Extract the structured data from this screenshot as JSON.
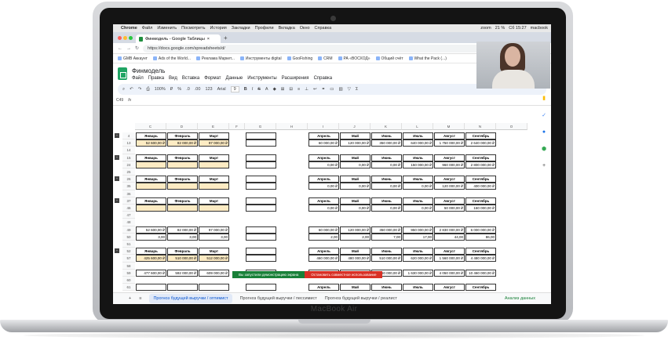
{
  "device": {
    "brand": "MacBook Air"
  },
  "macbar": {
    "app": "Chrome",
    "menu": [
      "Файл",
      "Изменить",
      "Посмотреть",
      "История",
      "Закладки",
      "Профили",
      "Вкладка",
      "Окно",
      "Справка"
    ],
    "zoom": "zoom",
    "battery": "21 %",
    "clock": "Сб 15:27",
    "user": "macbook"
  },
  "browser": {
    "tab_title": "Финмодель - Google Таблицы",
    "url": "https://docs.google.com/spreadsheets/d/",
    "bookmarks": [
      "GMB Аккаунт",
      "Ads of the World...",
      "Реклама Маркет...",
      "Инструменты digital",
      "GooFishing",
      "CRM",
      "РА «ВОСХОД»",
      "Общий счёт",
      "What the Pack (...)"
    ]
  },
  "doc": {
    "title": "Финмодель",
    "menus": [
      "Файл",
      "Правка",
      "Вид",
      "Вставка",
      "Формат",
      "Данные",
      "Инструменты",
      "Расширения",
      "Справка"
    ]
  },
  "toolbar": {
    "zoom": "100%",
    "currency": "₽",
    "percent": "%",
    "dec1": ".0",
    "dec2": ".00",
    "numfmt": "123",
    "font": "Arial",
    "size": "9"
  },
  "formula": {
    "cellref": "C49",
    "fx": "fx"
  },
  "columns": [
    "C",
    "D",
    "E",
    "F",
    "G",
    "H",
    "I",
    "J",
    "K",
    "L",
    "M",
    "N",
    "O"
  ],
  "rows": [
    {
      "n": "4",
      "left": [
        "Январь",
        "Февраль",
        "Март"
      ],
      "right": [
        "Апрель",
        "Май",
        "Июнь",
        "Июль",
        "Август",
        "Сентябрь"
      ],
      "hdr": true,
      "grp": "-"
    },
    {
      "n": "13",
      "left": [
        "52 600,00 ₽",
        "82 000,00 ₽",
        "97 000,00 ₽"
      ],
      "right": [
        "60 000,00 ₽",
        "120 000,00 ₽",
        "350 000,00 ₽",
        "640 000,00 ₽",
        "1 750 000,00 ₽",
        "2 640 000,00 ₽"
      ],
      "yl": true
    },
    {
      "n": "14",
      "left": [
        "",
        "",
        ""
      ],
      "right": [
        "",
        "",
        "",
        "",
        "",
        ""
      ],
      "blank": true
    },
    {
      "n": "15",
      "left": [
        "Январь",
        "Февраль",
        "Март"
      ],
      "right": [
        "Апрель",
        "Май",
        "Июнь",
        "Июль",
        "Август",
        "Сентябрь"
      ],
      "hdr": true,
      "grp": "-"
    },
    {
      "n": "24",
      "left": [
        "",
        "",
        ""
      ],
      "right": [
        "0,00 ₽",
        "0,00 ₽",
        "0,00 ₽",
        "150 000,00 ₽",
        "960 000,00 ₽",
        "2 800 000,00 ₽"
      ],
      "yl": true
    },
    {
      "n": "25",
      "left": [
        "",
        "",
        ""
      ],
      "right": [
        "",
        "",
        "",
        "",
        "",
        ""
      ],
      "blank": true
    },
    {
      "n": "26",
      "left": [
        "Январь",
        "Февраль",
        "Март"
      ],
      "right": [
        "Апрель",
        "Май",
        "Июнь",
        "Июль",
        "Август",
        "Сентябрь"
      ],
      "hdr": true,
      "grp": "-"
    },
    {
      "n": "35",
      "left": [
        "",
        "",
        ""
      ],
      "right": [
        "0,00 ₽",
        "0,00 ₽",
        "0,00 ₽",
        "0,00 ₽",
        "120 000,00 ₽",
        "400 000,00 ₽"
      ],
      "yl": true
    },
    {
      "n": "36",
      "left": [
        "",
        "",
        ""
      ],
      "right": [
        "",
        "",
        "",
        "",
        "",
        ""
      ],
      "blank": true
    },
    {
      "n": "37",
      "left": [
        "Январь",
        "Февраль",
        "Март"
      ],
      "right": [
        "Апрель",
        "Май",
        "Июнь",
        "Июль",
        "Август",
        "Сентябрь"
      ],
      "hdr": true,
      "grp": "-"
    },
    {
      "n": "46",
      "left": [
        "",
        "",
        ""
      ],
      "right": [
        "0,00 ₽",
        "0,00 ₽",
        "0,00 ₽",
        "0,00 ₽",
        "50 000,00 ₽",
        "160 000,00 ₽"
      ],
      "yl": true
    },
    {
      "n": "47",
      "left": [
        "",
        "",
        ""
      ],
      "right": [
        "",
        "",
        "",
        "",
        "",
        ""
      ],
      "blank": true
    },
    {
      "n": "48",
      "left": [
        "",
        "",
        ""
      ],
      "right": [
        "",
        "",
        "",
        "",
        "",
        ""
      ],
      "blank": true
    },
    {
      "n": "49",
      "left": [
        "52 600,00 ₽",
        "82 000,00 ₽",
        "97 000,00 ₽"
      ],
      "right": [
        "60 000,00 ₽",
        "120 000,00 ₽",
        "350 000,00 ₽",
        "950 000,00 ₽",
        "2 830 000,00 ₽",
        "6 000 000,00 ₽"
      ]
    },
    {
      "n": "50",
      "left": [
        "3,00",
        "3,00",
        "3,00"
      ],
      "right": [
        "2,00",
        "2,00",
        "7,00",
        "17,00",
        "44,00",
        "86,00"
      ]
    },
    {
      "n": "51",
      "left": [
        "",
        "",
        ""
      ],
      "right": [
        "",
        "",
        "",
        "",
        "",
        ""
      ],
      "blank": true
    },
    {
      "n": "52",
      "left": [
        "Январь",
        "Февраль",
        "Март"
      ],
      "right": [
        "Апрель",
        "Май",
        "Июнь",
        "Июль",
        "Август",
        "Сентябрь"
      ],
      "hdr": true,
      "grp": "-"
    },
    {
      "n": "57",
      "left": [
        "425 600,00 ₽",
        "510 000,00 ₽",
        "512 000,00 ₽"
      ],
      "right": [
        "460 000,00 ₽",
        "480 000,00 ₽",
        "510 000,00 ₽",
        "620 000,00 ₽",
        "1 560 000,00 ₽",
        "4 480 000,00 ₽"
      ],
      "yl": true
    },
    {
      "n": "58",
      "left": [
        "",
        "",
        ""
      ],
      "right": [
        "",
        "",
        "",
        "",
        "",
        ""
      ],
      "blank": true
    },
    {
      "n": "59",
      "left": [
        "477 600,00 ₽",
        "592 000,00 ₽",
        "609 000,00 ₽"
      ],
      "right": [
        "500 000,00 ₽",
        "580 000,00 ₽",
        "860 000,00 ₽",
        "1 630 000,00 ₽",
        "4 050 000,00 ₽",
        "10 460 000,00 ₽"
      ]
    },
    {
      "n": "60",
      "left": [
        "",
        "",
        ""
      ],
      "right": [
        "",
        "",
        "",
        "",
        "",
        ""
      ],
      "blank": true
    },
    {
      "n": "61",
      "left": [
        "",
        "",
        ""
      ],
      "right": [
        "Апрель",
        "Май",
        "Июнь",
        "Июль",
        "Август",
        "Сентябрь"
      ],
      "hdr": true
    }
  ],
  "sharebar": {
    "msg": "Вы запустили демонстрацию экрана",
    "stop": "Остановить совместное использование"
  },
  "sheets": [
    "Прогноз будущей выручки / оптимист",
    "Прогноз будущей выручки / пессимист",
    "Прогноз будущей выручки / реалист"
  ],
  "explore": "Анализ данных",
  "colors": {
    "accent": "#1fa463",
    "yellow": "#fdebc3"
  }
}
